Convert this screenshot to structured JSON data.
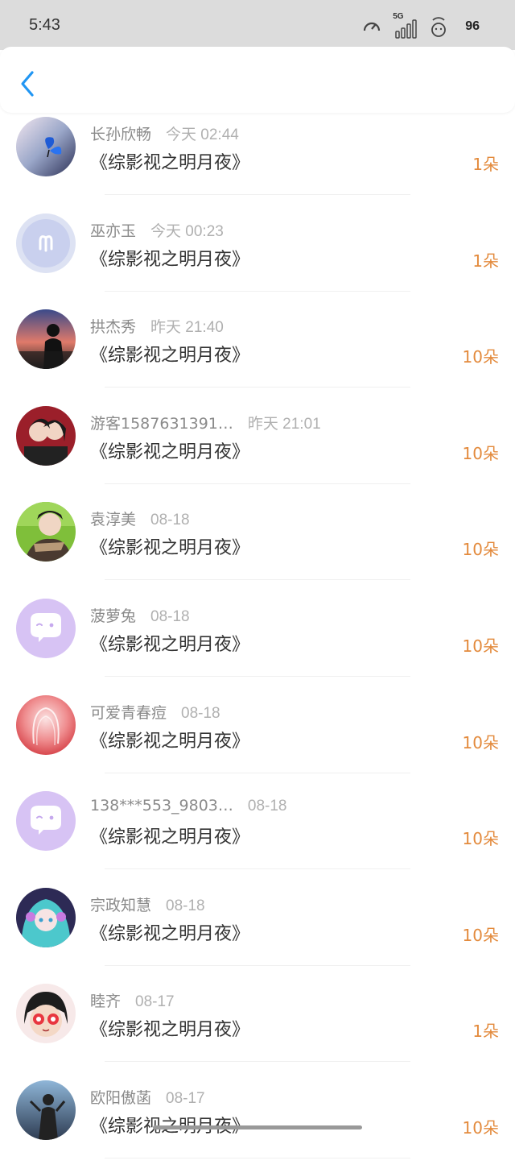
{
  "status": {
    "time": "5:43",
    "network": "5G",
    "battery": "96"
  },
  "nav": {
    "back_icon": "chevron-left-icon"
  },
  "colors": {
    "accent": "#2196f3",
    "amount": "#e38a3c",
    "name": "#8a8a8a",
    "time": "#b0b0b0"
  },
  "items": [
    {
      "name": "长孙欣畅",
      "time": "今天 02:44",
      "title": "《综影视之明月夜》",
      "amount": "1朵",
      "avatar": "butterfly-avatar"
    },
    {
      "name": "巫亦玉",
      "time": "今天 00:23",
      "title": "《综影视之明月夜》",
      "amount": "1朵",
      "avatar": "aries-avatar"
    },
    {
      "name": "拱杰秀",
      "time": "昨天 21:40",
      "title": "《综影视之明月夜》",
      "amount": "10朵",
      "avatar": "silhouette-sunset-avatar"
    },
    {
      "name": "游客1587631391…",
      "time": "昨天 21:01",
      "title": "《综影视之明月夜》",
      "amount": "10朵",
      "avatar": "couple-avatar"
    },
    {
      "name": "袁淳美",
      "time": "08-18",
      "title": "《综影视之明月夜》",
      "amount": "10朵",
      "avatar": "boy-scarf-avatar"
    },
    {
      "name": "菠萝兔",
      "time": "08-18",
      "title": "《综影视之明月夜》",
      "amount": "10朵",
      "avatar": "default-bubble-avatar"
    },
    {
      "name": "可爱青春痘",
      "time": "08-18",
      "title": "《综影视之明月夜》",
      "amount": "10朵",
      "avatar": "pink-girl-avatar"
    },
    {
      "name": "138***553_9803…",
      "time": "08-18",
      "title": "《综影视之明月夜》",
      "amount": "10朵",
      "avatar": "default-bubble-avatar"
    },
    {
      "name": "宗政知慧",
      "time": "08-18",
      "title": "《综影视之明月夜》",
      "amount": "10朵",
      "avatar": "miku-avatar"
    },
    {
      "name": "睦齐",
      "time": "08-17",
      "title": "《综影视之明月夜》",
      "amount": "1朵",
      "avatar": "cartoon-girl-avatar"
    },
    {
      "name": "欧阳傲菡",
      "time": "08-17",
      "title": "《综影视之明月夜》",
      "amount": "10朵",
      "avatar": "person-sky-avatar"
    }
  ]
}
